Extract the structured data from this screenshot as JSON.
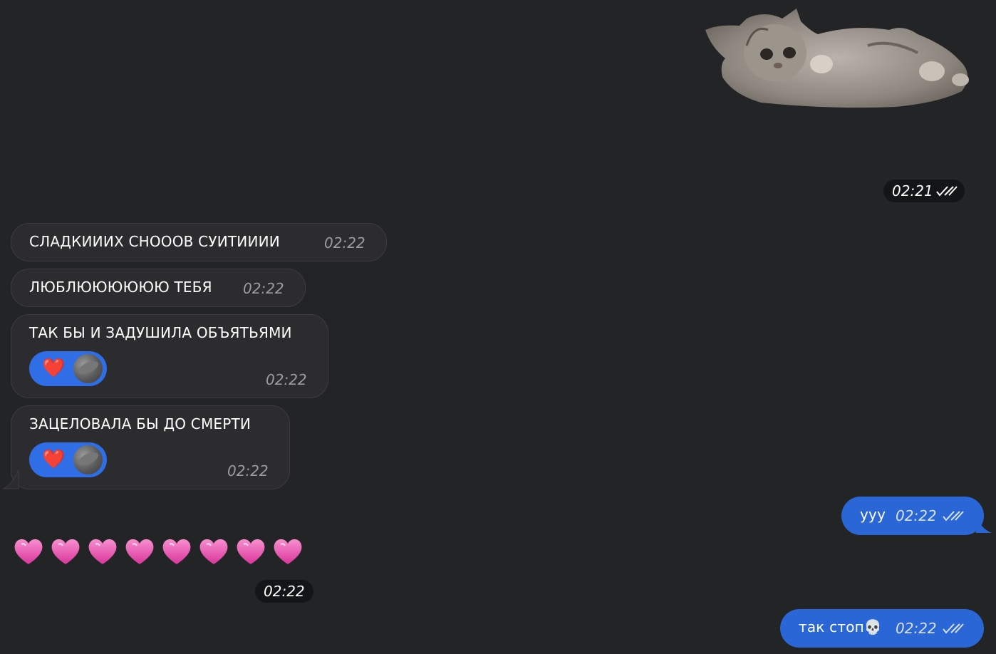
{
  "sticker": {
    "description_icon": "kitten-sticker-icon",
    "time": "02:21"
  },
  "incoming": [
    {
      "text": "СЛАДКИИИХ СНОООВ СУИТИИИИ",
      "time": "02:22"
    },
    {
      "text": "ЛЮБЛЮЮЮЮЮЮ ТЕБЯ",
      "time": "02:22"
    },
    {
      "text": "ТАК БЫ И ЗАДУШИЛА ОБЪЯТЬЯМИ",
      "time": "02:22",
      "reaction": "❤️"
    },
    {
      "text": "ЗАЦЕЛОВАЛА БЫ ДО СМЕРТИ",
      "time": "02:22",
      "reaction": "❤️"
    }
  ],
  "hearts_message": {
    "emoji_count": 8,
    "emoji": "💗",
    "time": "02:22"
  },
  "outgoing": [
    {
      "text": "ууу",
      "time": "02:22"
    },
    {
      "text": "так стоп💀",
      "time": "02:22"
    }
  ],
  "colors": {
    "background": "#222426",
    "incoming_bubble": "#2c2c2e",
    "outgoing_bubble": "#2b66d6",
    "reaction": "#2f6ee6"
  }
}
